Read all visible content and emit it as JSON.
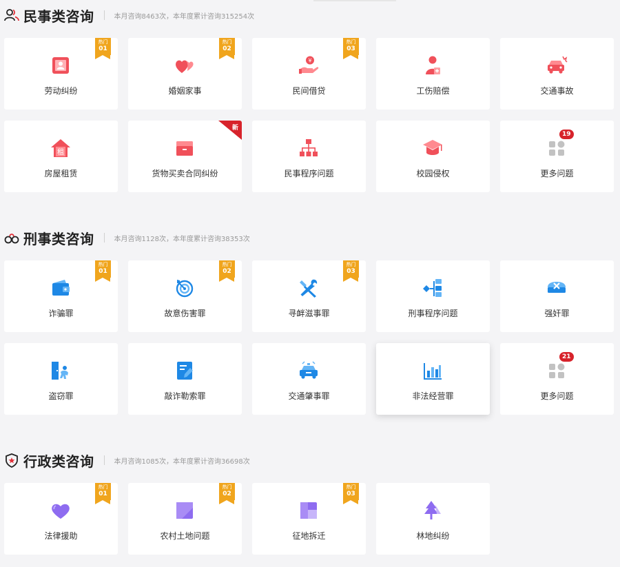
{
  "colors": {
    "civil_red": "#f0505a",
    "criminal_blue": "#1e88e5",
    "admin_purple": "#8e6cf0",
    "hot_orange": "#f0a51d",
    "new_red": "#d7232b",
    "more_gray": "#c2c2c2"
  },
  "sections": [
    {
      "id": "civil",
      "icon": "users-icon",
      "title": "民事类咨询",
      "stats": "本月咨询8463次，本年度累计咨询315254次",
      "items": [
        {
          "label": "劳动纠纷",
          "icon": "id-card-icon",
          "hot": {
            "t1": "热门",
            "t2": "01"
          }
        },
        {
          "label": "婚姻家事",
          "icon": "hearts-icon",
          "hot": {
            "t1": "热门",
            "t2": "02"
          }
        },
        {
          "label": "民间借贷",
          "icon": "hand-coin-icon",
          "coin": "¥",
          "hot": {
            "t1": "热门",
            "t2": "03"
          }
        },
        {
          "label": "工伤赔偿",
          "icon": "injured-person-icon"
        },
        {
          "label": "交通事故",
          "icon": "car-crash-icon"
        },
        {
          "label": "房屋租赁",
          "icon": "house-rent-icon",
          "glyph": "租"
        },
        {
          "label": "货物买卖合同纠纷",
          "icon": "cargo-box-icon",
          "new": "新"
        },
        {
          "label": "民事程序问题",
          "icon": "org-chart-icon"
        },
        {
          "label": "校园侵权",
          "icon": "graduation-cap-icon"
        },
        {
          "label": "更多问题",
          "icon": "more-grid-icon",
          "count": "19"
        }
      ]
    },
    {
      "id": "criminal",
      "icon": "handcuffs-icon",
      "title": "刑事类咨询",
      "stats": "本月咨询1128次，本年度累计咨询38353次",
      "items": [
        {
          "label": "诈骗罪",
          "icon": "wallet-icon",
          "hot": {
            "t1": "热门",
            "t2": "01"
          }
        },
        {
          "label": "故意伤害罪",
          "icon": "target-icon",
          "hot": {
            "t1": "热门",
            "t2": "02"
          }
        },
        {
          "label": "寻衅滋事罪",
          "icon": "tools-icon",
          "hot": {
            "t1": "热门",
            "t2": "03"
          }
        },
        {
          "label": "刑事程序问题",
          "icon": "flowchart-icon"
        },
        {
          "label": "强奸罪",
          "icon": "cross-box-icon"
        },
        {
          "label": "盗窃罪",
          "icon": "thief-door-icon"
        },
        {
          "label": "敲诈勒索罪",
          "icon": "document-pen-icon"
        },
        {
          "label": "交通肇事罪",
          "icon": "police-car-icon"
        },
        {
          "label": "非法经营罪",
          "icon": "bar-chart-icon",
          "raised": true
        },
        {
          "label": "更多问题",
          "icon": "more-grid-icon",
          "count": "21"
        }
      ]
    },
    {
      "id": "administrative",
      "icon": "police-badge-icon",
      "title": "行政类咨询",
      "stats": "本月咨询1085次，本年度累计咨询36698次",
      "items": [
        {
          "label": "法律援助",
          "icon": "heart-icon",
          "hot": {
            "t1": "热门",
            "t2": "01"
          }
        },
        {
          "label": "农村土地问题",
          "icon": "land-square-icon",
          "hot": {
            "t1": "热门",
            "t2": "02"
          }
        },
        {
          "label": "征地拆迁",
          "icon": "land-grid-icon",
          "hot": {
            "t1": "热门",
            "t2": "03"
          }
        },
        {
          "label": "林地纠纷",
          "icon": "tree-icon"
        }
      ]
    }
  ]
}
